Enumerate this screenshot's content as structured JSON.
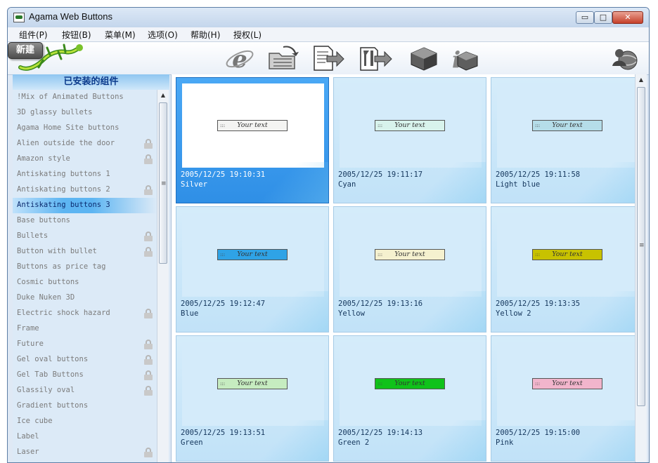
{
  "window": {
    "title": "Agama Web Buttons",
    "controls": {
      "minimize": "▭",
      "maximize": "□",
      "close": "✕"
    }
  },
  "menu": [
    "组件(P)",
    "按钮(B)",
    "菜单(M)",
    "选项(O)",
    "帮助(H)",
    "授权(L)"
  ],
  "toolbar": {
    "new_label": "新建",
    "icons": [
      "lizard-logo-icon",
      "internet-explorer-icon",
      "open-folder-icon",
      "export-document-icon",
      "build-tool-icon",
      "cube-icon",
      "info-icon",
      "user-globe-icon"
    ]
  },
  "sidebar": {
    "header": "已安装的组件",
    "items": [
      {
        "label": "!Mix of Animated Buttons",
        "locked": false,
        "selected": false
      },
      {
        "label": "3D glassy bullets",
        "locked": false,
        "selected": false
      },
      {
        "label": "Agama Home Site buttons",
        "locked": false,
        "selected": false
      },
      {
        "label": "Alien outside the door",
        "locked": true,
        "selected": false
      },
      {
        "label": "Amazon style",
        "locked": true,
        "selected": false
      },
      {
        "label": "Antiskating buttons 1",
        "locked": false,
        "selected": false
      },
      {
        "label": "Antiskating buttons 2",
        "locked": true,
        "selected": false
      },
      {
        "label": "Antiskating buttons 3",
        "locked": false,
        "selected": true
      },
      {
        "label": "Base buttons",
        "locked": false,
        "selected": false
      },
      {
        "label": "Bullets",
        "locked": true,
        "selected": false
      },
      {
        "label": "Button with bullet",
        "locked": true,
        "selected": false
      },
      {
        "label": "Buttons as price tag",
        "locked": false,
        "selected": false
      },
      {
        "label": "Cosmic buttons",
        "locked": false,
        "selected": false
      },
      {
        "label": "Duke Nuken 3D",
        "locked": false,
        "selected": false
      },
      {
        "label": "Electric shock hazard",
        "locked": true,
        "selected": false
      },
      {
        "label": "Frame",
        "locked": false,
        "selected": false
      },
      {
        "label": "Future",
        "locked": true,
        "selected": false
      },
      {
        "label": "Gel oval buttons",
        "locked": true,
        "selected": false
      },
      {
        "label": "Gel Tab Buttons",
        "locked": true,
        "selected": false
      },
      {
        "label": "Glassily oval",
        "locked": true,
        "selected": false
      },
      {
        "label": "Gradient buttons",
        "locked": false,
        "selected": false
      },
      {
        "label": "Ice cube",
        "locked": false,
        "selected": false
      },
      {
        "label": "Label",
        "locked": false,
        "selected": false
      },
      {
        "label": "Laser",
        "locked": true,
        "selected": false
      }
    ]
  },
  "cards": [
    {
      "date": "2005/12/25 19:10:31",
      "name": "Silver",
      "button_text": "Your text",
      "color": "#f4f4f2",
      "selected": true
    },
    {
      "date": "2005/12/25 19:11:17",
      "name": "Cyan",
      "button_text": "Your text",
      "color": "#d8f3ec",
      "selected": false
    },
    {
      "date": "2005/12/25 19:11:58",
      "name": "Light blue",
      "button_text": "Your text",
      "color": "#b5dde9",
      "selected": false
    },
    {
      "date": "2005/12/25 19:12:47",
      "name": "Blue",
      "button_text": "Your text",
      "color": "#2fa3e6",
      "selected": false
    },
    {
      "date": "2005/12/25 19:13:16",
      "name": "Yellow",
      "button_text": "Your text",
      "color": "#f5f1cf",
      "selected": false
    },
    {
      "date": "2005/12/25 19:13:35",
      "name": "Yellow 2",
      "button_text": "Your text",
      "color": "#c8c200",
      "selected": false
    },
    {
      "date": "2005/12/25 19:13:51",
      "name": "Green",
      "button_text": "Your text",
      "color": "#c6ecc0",
      "selected": false
    },
    {
      "date": "2005/12/25 19:14:13",
      "name": "Green 2",
      "button_text": "Your text",
      "color": "#10c21a",
      "selected": false
    },
    {
      "date": "2005/12/25 19:15:00",
      "name": "Pink",
      "button_text": "Your text",
      "color": "#f2b5cc",
      "selected": false
    }
  ],
  "scrollbar": {
    "up_arrow": "▲",
    "grip": "≡"
  }
}
